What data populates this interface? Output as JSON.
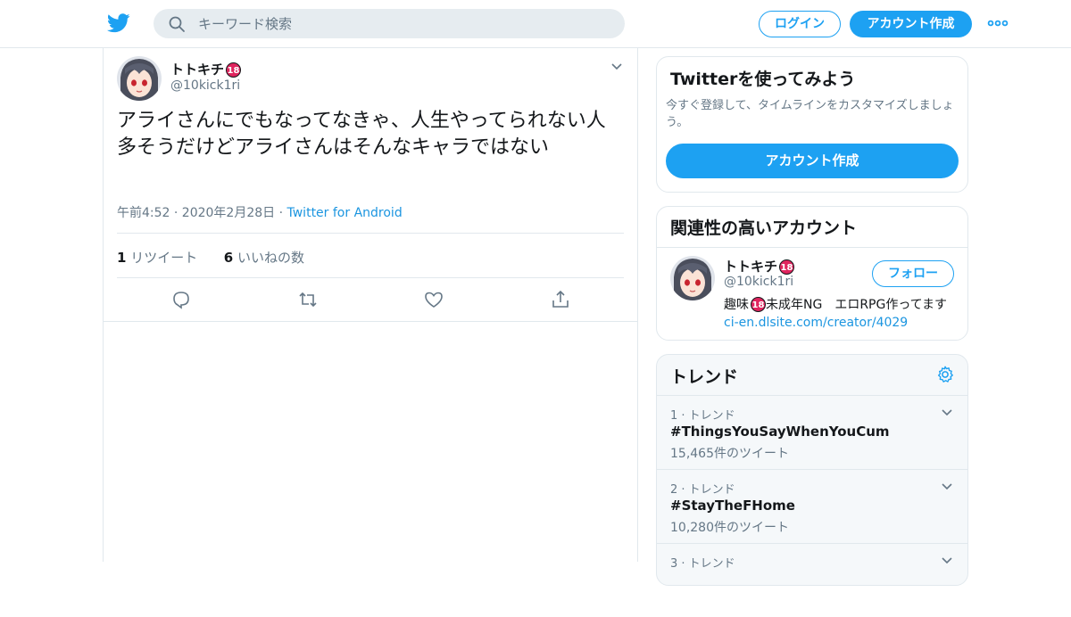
{
  "header": {
    "search_placeholder": "キーワード検索",
    "login_label": "ログイン",
    "signup_label": "アカウント作成"
  },
  "tweet": {
    "name": "トトキチ",
    "badge": "18",
    "handle": "@10kick1ri",
    "text": "アライさんにでもなってなきゃ、人生やってられない人多そうだけどアライさんはそんなキャラではない",
    "time": "午前4:52 · 2020年2月28日 · ",
    "source": "Twitter for Android",
    "retweet_count": "1",
    "retweet_label": "リツイート",
    "like_count": "6",
    "like_label": "いいねの数"
  },
  "signup_card": {
    "title": "Twitterを使ってみよう",
    "description": "今すぐ登録して、タイムラインをカスタマイズしましょう。",
    "button": "アカウント作成"
  },
  "related": {
    "title": "関連性の高いアカウント",
    "name": "トトキチ",
    "badge": "18",
    "handle": "@10kick1ri",
    "follow_label": "フォロー",
    "bio_text": "趣味",
    "bio_badge": "18",
    "bio_rest": "未成年NG　エロRPG作ってます　",
    "bio_link": "ci-en.dlsite.com/creator/4029"
  },
  "trends": {
    "title": "トレンド",
    "items": [
      {
        "rank": "1 · トレンド",
        "name": "#ThingsYouSayWhenYouCum",
        "count": "15,465件のツイート"
      },
      {
        "rank": "2 · トレンド",
        "name": "#StayTheFHome",
        "count": "10,280件のツイート"
      },
      {
        "rank": "3 · トレンド",
        "name": "",
        "count": ""
      }
    ]
  },
  "colors": {
    "accent": "#1da1f2",
    "text": "#14171a",
    "muted": "#657786",
    "border": "#e1e8ed"
  }
}
